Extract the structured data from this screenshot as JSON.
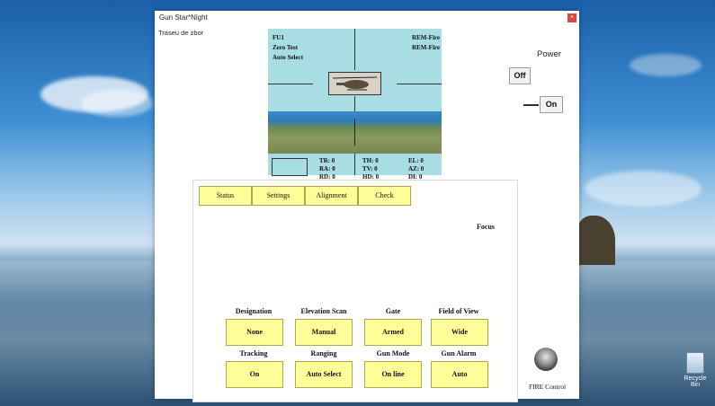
{
  "window": {
    "title": "Gun Star*Night",
    "close_glyph": "×"
  },
  "menu": {
    "item": "Traseu de zbor"
  },
  "display": {
    "top_left": [
      "FU1",
      "Zero Test",
      "Auto Select"
    ],
    "top_right": [
      "REM-Fire",
      "REM-Fire"
    ],
    "readouts": [
      [
        "TR: 0",
        "TH: 0",
        "EL: 0"
      ],
      [
        "RA: 0",
        "TV: 0",
        "AZ: 0"
      ],
      [
        "RD: 0",
        "HD: 0",
        "DI: 0"
      ]
    ]
  },
  "tabs": [
    "Status",
    "Settings",
    "Alignment",
    "Check"
  ],
  "focus_label": "Focus",
  "controls_row1": [
    {
      "caption": "Designation",
      "value": "None"
    },
    {
      "caption": "Elevation Scan",
      "value": "Manual"
    },
    {
      "caption": "Gate",
      "value": "Armed"
    },
    {
      "caption": "Field of View",
      "value": "Wide"
    }
  ],
  "controls_row2": [
    {
      "caption": "Tracking",
      "value": "On"
    },
    {
      "caption": "Ranging",
      "value": "Auto Select"
    },
    {
      "caption": "Gun Mode",
      "value": "On line"
    },
    {
      "caption": "Gun Alarm",
      "value": "Auto"
    }
  ],
  "power": {
    "label": "Power",
    "off": "Off",
    "on": "On"
  },
  "fire_control": {
    "label": "FIRE Control"
  },
  "desktop": {
    "recycle_bin": "Recycle Bin"
  },
  "icons": {
    "close": "close-icon",
    "joystick": "joystick-icon",
    "recycle": "recycle-bin-icon",
    "helicopter": "helicopter-icon"
  }
}
